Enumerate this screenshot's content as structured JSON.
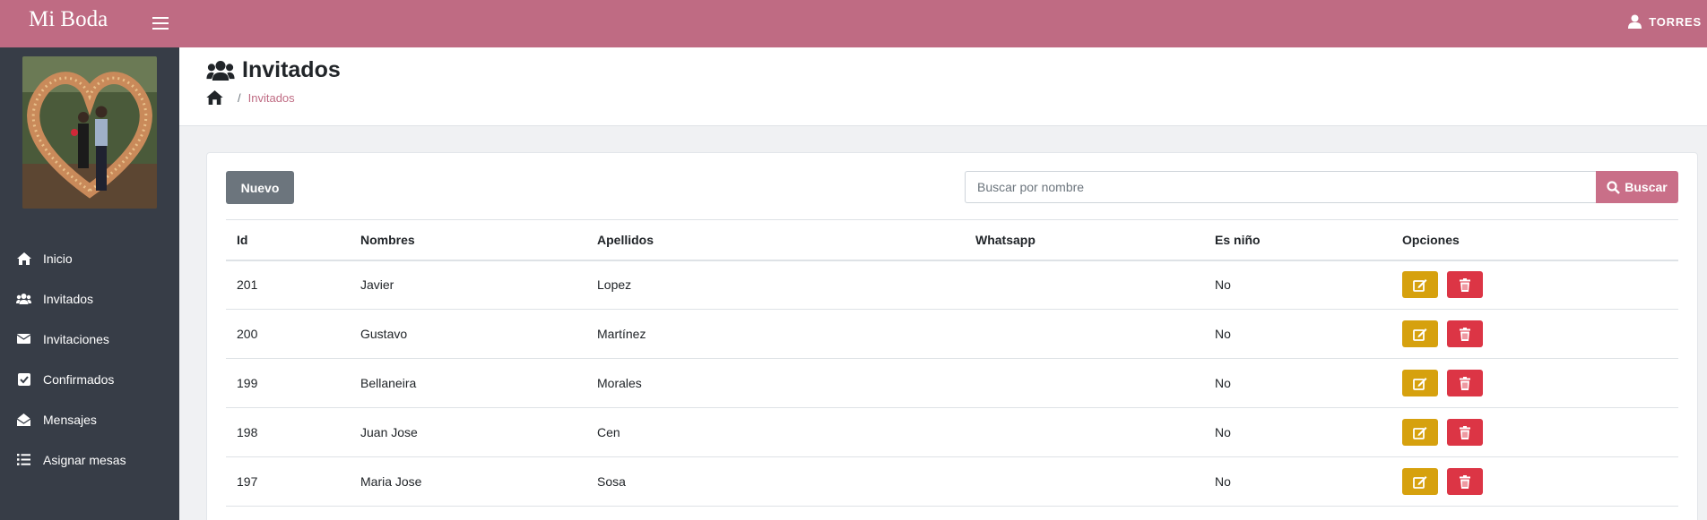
{
  "app": {
    "title": "Mi Boda",
    "user": "TORRES"
  },
  "sidebar": {
    "items": [
      {
        "label": "Inicio",
        "icon": "home-icon"
      },
      {
        "label": "Invitados",
        "icon": "users-icon"
      },
      {
        "label": "Invitaciones",
        "icon": "envelope-icon"
      },
      {
        "label": "Confirmados",
        "icon": "check-square-icon"
      },
      {
        "label": "Mensajes",
        "icon": "envelope-open-icon"
      },
      {
        "label": "Asignar mesas",
        "icon": "list-icon"
      }
    ]
  },
  "header": {
    "title": "Invitados",
    "breadcrumb_current": "Invitados"
  },
  "toolbar": {
    "new_label": "Nuevo",
    "search_placeholder": "Buscar por nombre",
    "search_label": "Buscar"
  },
  "table": {
    "columns": [
      "Id",
      "Nombres",
      "Apellidos",
      "Whatsapp",
      "Es niño",
      "Opciones"
    ],
    "rows": [
      {
        "id": "201",
        "nombres": "Javier",
        "apellidos": "Lopez",
        "whatsapp": "",
        "es_nino": "No"
      },
      {
        "id": "200",
        "nombres": "Gustavo",
        "apellidos": "Martínez",
        "whatsapp": "",
        "es_nino": "No"
      },
      {
        "id": "199",
        "nombres": "Bellaneira",
        "apellidos": "Morales",
        "whatsapp": "",
        "es_nino": "No"
      },
      {
        "id": "198",
        "nombres": "Juan Jose",
        "apellidos": "Cen",
        "whatsapp": "",
        "es_nino": "No"
      },
      {
        "id": "197",
        "nombres": "Maria Jose",
        "apellidos": "Sosa",
        "whatsapp": "",
        "es_nino": "No"
      }
    ]
  },
  "colors": {
    "brand": "#bf6b83",
    "sidebar": "#373d47",
    "edit": "#d6a10e",
    "delete": "#dc3545"
  }
}
